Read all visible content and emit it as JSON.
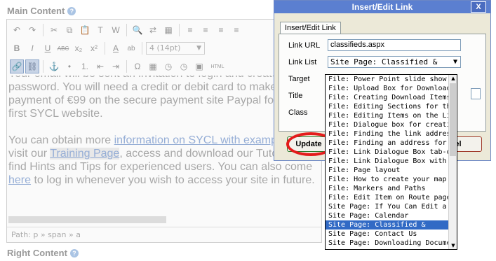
{
  "editor": {
    "main_label": "Main Content",
    "right_label": "Right Content",
    "help_glyph": "?",
    "font_size_value": "4 (14pt)",
    "paragraph1": "Your email will be sent an invitation to login and create a password. You will need a credit or debit card to make a payment of €99 on the secure payment site Paypal for your first SYCL website.",
    "p2_a": "You can obtain more ",
    "p2_link1": "information on SYCL with example sites",
    "p2_b": ", visit our ",
    "p2_link2": "Training Page",
    "p2_c": ", access and download our Tutorial, or find Hints and Tips for experienced users. You can also come ",
    "p2_link3": "here",
    "p2_d": " to log in whenever you wish to access your site in future.",
    "path_text": "Path: p » span » a",
    "toolbar_glyphs": {
      "undo": "↶",
      "redo": "↷",
      "cut": "✂",
      "copy": "⧉",
      "paste": "📋",
      "paste_text": "T",
      "paste_word": "W",
      "find": "🔍",
      "replace": "⇄",
      "select_all": "▦",
      "align_left": "≡",
      "align_center": "≡",
      "align_right": "≡",
      "justify": "≡",
      "bold": "B",
      "italic": "I",
      "underline": "U",
      "strike": "ABC",
      "subscript": "x₂",
      "superscript": "x²",
      "font_color": "A",
      "highlight": "ab",
      "list_bullets": "•",
      "list_numbers": "1.",
      "outdent": "⇤",
      "indent": "⇥",
      "link": "🔗",
      "unlink": "⛓",
      "anchor": "⚓",
      "image": "▣",
      "special_char": "Ω",
      "table": "▦",
      "hr": "—",
      "date": "◷",
      "time": "◷",
      "html": "HTML"
    }
  },
  "dialog": {
    "title": "Insert/Edit Link",
    "close_glyph": "X",
    "tab_label": "Insert/Edit Link",
    "link_url_label": "Link URL",
    "link_url_value": "classifieds.aspx",
    "link_list_label": "Link List",
    "link_list_value": "Site Page: Classified &",
    "target_label": "Target",
    "title_label": "Title",
    "class_label": "Class",
    "update_label": "Update",
    "cancel_label": "el"
  },
  "dropdown": {
    "items": [
      "File: Power Point slide show a",
      "File: Upload Box for Download",
      "File: Creating Download Items",
      "File: Editing Sections for the",
      "File: Editing Items on the Lin",
      "File: Dialogue box for creatin",
      "File: Finding the link address",
      "File: Finding an address for a",
      "File: Link Dialogue Box tab-op",
      "File: Link Dialogue Box with a",
      "File: Page layout",
      "File: How to create your map",
      "File: Markers and Paths",
      "File: Edit Item on Route page",
      "Site Page: If You Can Edit a T",
      "Site Page: Calendar",
      "Site Page: Classified &",
      "Site Page: Contact Us",
      "Site Page: Downloading Docume"
    ],
    "selected_index": 16
  },
  "colors": {
    "titlebar": "#5b7fd0",
    "selection": "#316ac5",
    "highlight_oval": "#e41b1b"
  }
}
